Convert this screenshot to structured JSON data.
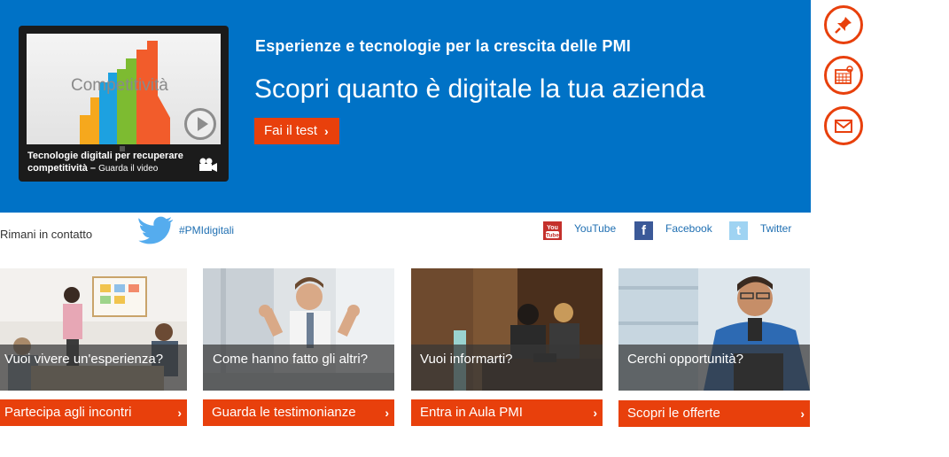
{
  "hero": {
    "subtitle": "Esperienze e tecnologie per la crescita delle PMI",
    "title": "Scopri quanto è digitale la tua azienda",
    "cta_label": "Fai il test",
    "cta_chevron": "›",
    "video": {
      "screen_word": "Competitività",
      "caption_main": "Tecnologie digitali per recuperare competitività –",
      "caption_sub": "Guarda il video",
      "icons": [
        "play-icon",
        "video-camera-icon"
      ]
    }
  },
  "side_actions": [
    {
      "name": "pin-icon"
    },
    {
      "name": "calendar-icon"
    },
    {
      "name": "mail-icon"
    }
  ],
  "social": {
    "contact_label": "Rimani in contatto",
    "hashtag": "#PMIdigitali",
    "links": [
      {
        "label": "YouTube",
        "icon": "youtube-icon",
        "color": "#c4302b",
        "glyph": "You Tube"
      },
      {
        "label": "Facebook",
        "icon": "facebook-icon",
        "color": "#3b5998",
        "glyph": "f"
      },
      {
        "label": "Twitter",
        "icon": "twitter-icon",
        "color": "#55acee",
        "glyph": "t"
      }
    ]
  },
  "cards": [
    {
      "overlay": "Vuoi vivere un'esperienza?",
      "button": "Partecipa agli incontri"
    },
    {
      "overlay": "Come hanno fatto gli altri?",
      "button": "Guarda le testimonianze"
    },
    {
      "overlay": "Vuoi informarti?",
      "button": "Entra in Aula PMI"
    },
    {
      "overlay": "Cerchi opportunità?",
      "button": "Scopri le offerte"
    }
  ],
  "colors": {
    "hero_blue": "#0072c6",
    "accent_orange": "#e8400c",
    "link_blue": "#1f6fb2"
  }
}
